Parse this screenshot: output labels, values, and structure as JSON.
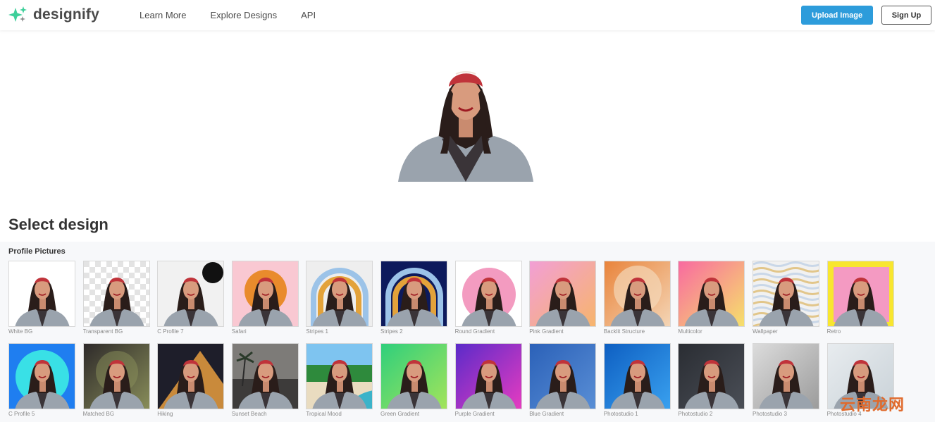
{
  "nav": {
    "brand": "designify",
    "links": [
      "Learn More",
      "Explore Designs",
      "API"
    ],
    "upload_label": "Upload Image",
    "signup_label": "Sign Up"
  },
  "colors": {
    "accent": "#2d9cdb",
    "brand_green": "#3ecf9a"
  },
  "section_title": "Select design",
  "category": "Profile Pictures",
  "row1": [
    {
      "label": "White BG",
      "bg": "#ffffff",
      "style": "plain"
    },
    {
      "label": "Transparent BG",
      "bg": "#e9e9e9",
      "style": "checker"
    },
    {
      "label": "C Profile 7",
      "bg": "#f1f1f1",
      "style": "badge"
    },
    {
      "label": "Safari",
      "bg": "#f9c8d2",
      "style": "sun",
      "accent": "#e98b2c"
    },
    {
      "label": "Stripes 1",
      "bg": "#eeeeee",
      "style": "rainbow",
      "accent": "#e3a23a"
    },
    {
      "label": "Stripes 2",
      "bg": "#0d1a5c",
      "style": "rainbow",
      "accent": "#e3a23a"
    },
    {
      "label": "Round Gradient",
      "bg": "#ffffff",
      "style": "circle",
      "accent": "#f39bc0"
    },
    {
      "label": "Pink Gradient",
      "bg": "#f29fd5",
      "style": "gradient",
      "accent": "#f7b56a"
    },
    {
      "label": "Backlit Structure",
      "bg": "#e9843b",
      "style": "backlit",
      "accent": "#f4d7b8"
    },
    {
      "label": "Multicolor",
      "bg": "#f86aa0",
      "style": "gradient",
      "accent": "#f6e36a"
    },
    {
      "label": "Wallpaper",
      "bg": "#c9d7e8",
      "style": "waves",
      "accent": "#e2c68a"
    },
    {
      "label": "Retro",
      "bg": "#f8e62f",
      "style": "frame",
      "accent": "#f49ac2"
    }
  ],
  "row2": [
    {
      "label": "C Profile 5",
      "bg": "#1f7ef0",
      "style": "circle",
      "accent": "#39e0e6"
    },
    {
      "label": "Matched BG",
      "bg": "#2e2a2a",
      "style": "glow",
      "accent": "#8a8f5a"
    },
    {
      "label": "Hiking",
      "bg": "#c98a3b",
      "style": "dune",
      "accent": "#2a2a3a"
    },
    {
      "label": "Sunset Beach",
      "bg": "#7d7b78",
      "style": "beach",
      "accent": "#3d3b3a"
    },
    {
      "label": "Tropical Mood",
      "bg": "#46a7e6",
      "style": "tropical",
      "accent": "#e9dcc0"
    },
    {
      "label": "Green Gradient",
      "bg": "#2fcf7c",
      "style": "gradient",
      "accent": "#a5e45a"
    },
    {
      "label": "Purple Gradient",
      "bg": "#5b2bc9",
      "style": "gradient",
      "accent": "#e83cc0"
    },
    {
      "label": "Blue Gradient",
      "bg": "#2b61b8",
      "style": "gradient",
      "accent": "#5a8fd6"
    },
    {
      "label": "Photostudio 1",
      "bg": "#0e5fc2",
      "style": "gradient",
      "accent": "#3aa2f0"
    },
    {
      "label": "Photostudio 2",
      "bg": "#2a2d33",
      "style": "gradient",
      "accent": "#4b4f57"
    },
    {
      "label": "Photostudio 3",
      "bg": "#dcdcdc",
      "style": "gradient",
      "accent": "#9a9a9a"
    },
    {
      "label": "Photostudio 4",
      "bg": "#e8ecef",
      "style": "gradient",
      "accent": "#c9d2d8"
    }
  ],
  "watermark": "云南龙网"
}
